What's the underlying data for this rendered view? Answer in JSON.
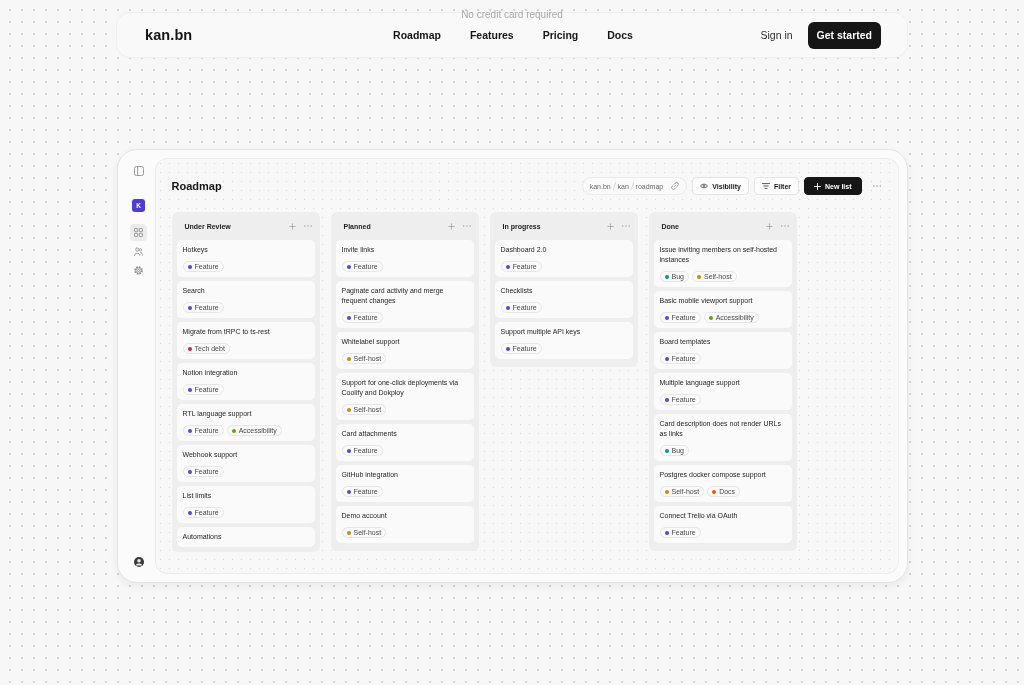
{
  "hero_note": "No credit card required",
  "nav": {
    "logo": "kan.bn",
    "links": [
      "Roadmap",
      "Features",
      "Pricing",
      "Docs"
    ],
    "sign_in": "Sign in",
    "cta": "Get started"
  },
  "sidebar": {
    "workspace_initial": "K",
    "items": [
      {
        "kind": "boards",
        "selected": true
      },
      {
        "kind": "members",
        "selected": false
      },
      {
        "kind": "settings",
        "selected": false
      }
    ]
  },
  "board": {
    "title": "Roadmap",
    "breadcrumb": [
      "kan.bn",
      "kan",
      "roadmap"
    ],
    "visibility_button": "Visibility",
    "filter_button": "Filter",
    "new_list_button": "New list"
  },
  "lists": [
    {
      "title": "Under Review",
      "cards": [
        {
          "title": "Hotkeys",
          "tags": [
            {
              "label": "Feature",
              "color": "#4f46e5"
            }
          ]
        },
        {
          "title": "Search",
          "tags": [
            {
              "label": "Feature",
              "color": "#4f46e5"
            }
          ]
        },
        {
          "title": "Migrate from tRPC to ts-rest",
          "tags": [
            {
              "label": "Tech debt",
              "color": "#e11d48"
            }
          ]
        },
        {
          "title": "Notion integration",
          "tags": [
            {
              "label": "Feature",
              "color": "#4f46e5"
            }
          ]
        },
        {
          "title": "RTL language support",
          "tags": [
            {
              "label": "Feature",
              "color": "#4f46e5"
            },
            {
              "label": "Accessibility",
              "color": "#65a30d"
            }
          ]
        },
        {
          "title": "Webhook support",
          "tags": [
            {
              "label": "Feature",
              "color": "#4f46e5"
            }
          ]
        },
        {
          "title": "List limits",
          "tags": [
            {
              "label": "Feature",
              "color": "#4f46e5"
            }
          ]
        },
        {
          "title": "Automations"
        }
      ]
    },
    {
      "title": "Planned",
      "cards": [
        {
          "title": "Invite links",
          "tags": [
            {
              "label": "Feature",
              "color": "#4f46e5"
            }
          ]
        },
        {
          "title": "Paginate card activity and merge frequent changes",
          "tags": [
            {
              "label": "Feature",
              "color": "#4f46e5"
            }
          ]
        },
        {
          "title": "Whitelabel support",
          "tags": [
            {
              "label": "Self-host",
              "color": "#ca8a04"
            }
          ]
        },
        {
          "title": "Support for one-click deployments via Coolify and Dokploy",
          "tags": [
            {
              "label": "Self-host",
              "color": "#ca8a04"
            }
          ]
        },
        {
          "title": "Card attachments",
          "tags": [
            {
              "label": "Feature",
              "color": "#4f46e5"
            }
          ]
        },
        {
          "title": "GitHub integration",
          "tags": [
            {
              "label": "Feature",
              "color": "#4f46e5"
            }
          ]
        },
        {
          "title": "Demo account",
          "tags": [
            {
              "label": "Self-host",
              "color": "#ca8a04"
            }
          ]
        }
      ]
    },
    {
      "title": "In progress",
      "cards": [
        {
          "title": "Dashboard 2.0",
          "tags": [
            {
              "label": "Feature",
              "color": "#4f46e5"
            }
          ]
        },
        {
          "title": "Checklists",
          "tags": [
            {
              "label": "Feature",
              "color": "#4f46e5"
            }
          ]
        },
        {
          "title": "Support multiple API keys",
          "tags": [
            {
              "label": "Feature",
              "color": "#4f46e5"
            }
          ]
        }
      ]
    },
    {
      "title": "Done",
      "cards": [
        {
          "title": "Issue inviting members on self-hosted instances",
          "tags": [
            {
              "label": "Bug",
              "color": "#0d9488"
            },
            {
              "label": "Self-host",
              "color": "#ca8a04"
            }
          ]
        },
        {
          "title": "Basic mobile viewport support",
          "tags": [
            {
              "label": "Feature",
              "color": "#4f46e5"
            },
            {
              "label": "Accessibility",
              "color": "#65a30d"
            }
          ]
        },
        {
          "title": "Board templates",
          "tags": [
            {
              "label": "Feature",
              "color": "#4f46e5"
            }
          ]
        },
        {
          "title": "Multiple language support",
          "tags": [
            {
              "label": "Feature",
              "color": "#4f46e5"
            }
          ]
        },
        {
          "title": "Card description does not render URLs as links",
          "tags": [
            {
              "label": "Bug",
              "color": "#0d9488"
            }
          ]
        },
        {
          "title": "Postgres docker compose support",
          "tags": [
            {
              "label": "Self-host",
              "color": "#ca8a04"
            },
            {
              "label": "Docs",
              "color": "#ea580c"
            }
          ]
        },
        {
          "title": "Connect Trello via OAuth",
          "tags": [
            {
              "label": "Feature",
              "color": "#4f46e5"
            }
          ]
        }
      ]
    }
  ]
}
